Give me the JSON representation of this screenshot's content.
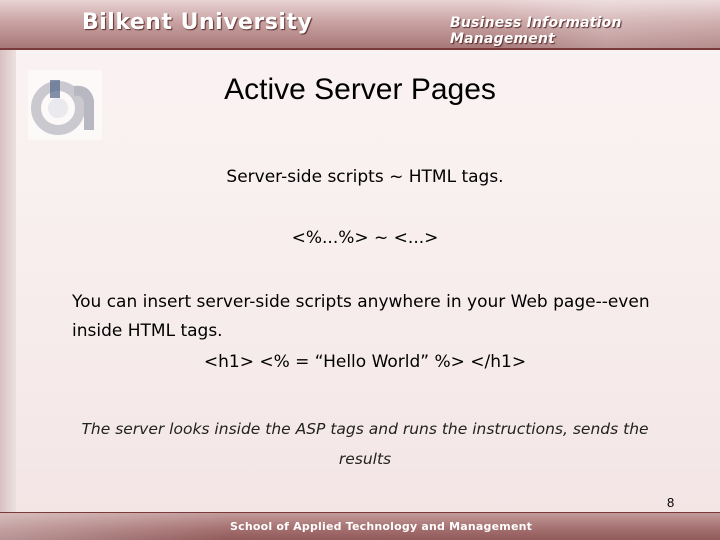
{
  "header": {
    "brand": "Bilkent University",
    "department": "Business Information Management"
  },
  "slide": {
    "title": "Active Server Pages",
    "line1": "Server-side scripts ~ HTML tags.",
    "line2": "<%...%> ~ <...>",
    "line3": "You can insert server-side scripts anywhere in your Web page--even inside HTML tags.",
    "code_open": "<h1> ",
    "code_asp": "<% = “Hello World” %>",
    "code_close": " </h1>",
    "note": "The server looks inside the ASP tags and runs the instructions, sends the results",
    "page_number": "8"
  },
  "footer": {
    "text": "School of Applied Technology and Management"
  },
  "colors": {
    "header": "#b58888",
    "footer": "#a57070",
    "background": "#f7ecec"
  },
  "icons": [
    "bilkent-logo-icon"
  ]
}
